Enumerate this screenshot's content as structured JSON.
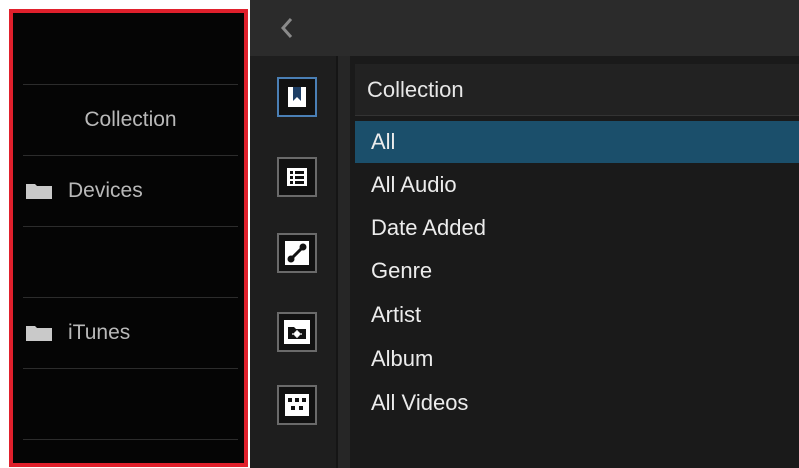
{
  "left_panel": {
    "rows": [
      {
        "label": "",
        "icon": ""
      },
      {
        "label": "Collection",
        "icon": ""
      },
      {
        "label": "Devices",
        "icon": "folder-icon"
      },
      {
        "label": "",
        "icon": ""
      },
      {
        "label": "iTunes",
        "icon": "folder-icon"
      },
      {
        "label": "",
        "icon": ""
      }
    ],
    "highlight_color": "#e0202c"
  },
  "toolbar": {
    "back_icon": "chevron-left-icon",
    "tools": [
      {
        "name": "bookmark-icon",
        "active": true
      },
      {
        "name": "table-icon",
        "active": false
      },
      {
        "name": "link-icon",
        "active": false
      },
      {
        "name": "folder-network-icon",
        "active": false
      },
      {
        "name": "grid-icon",
        "active": false
      }
    ]
  },
  "main": {
    "header": "Collection",
    "items": [
      "All",
      "All Audio",
      "Date Added",
      "Genre",
      "Artist",
      "Album",
      "All Videos"
    ],
    "selected_index": 0,
    "selection_color": "#1b4f6b"
  }
}
